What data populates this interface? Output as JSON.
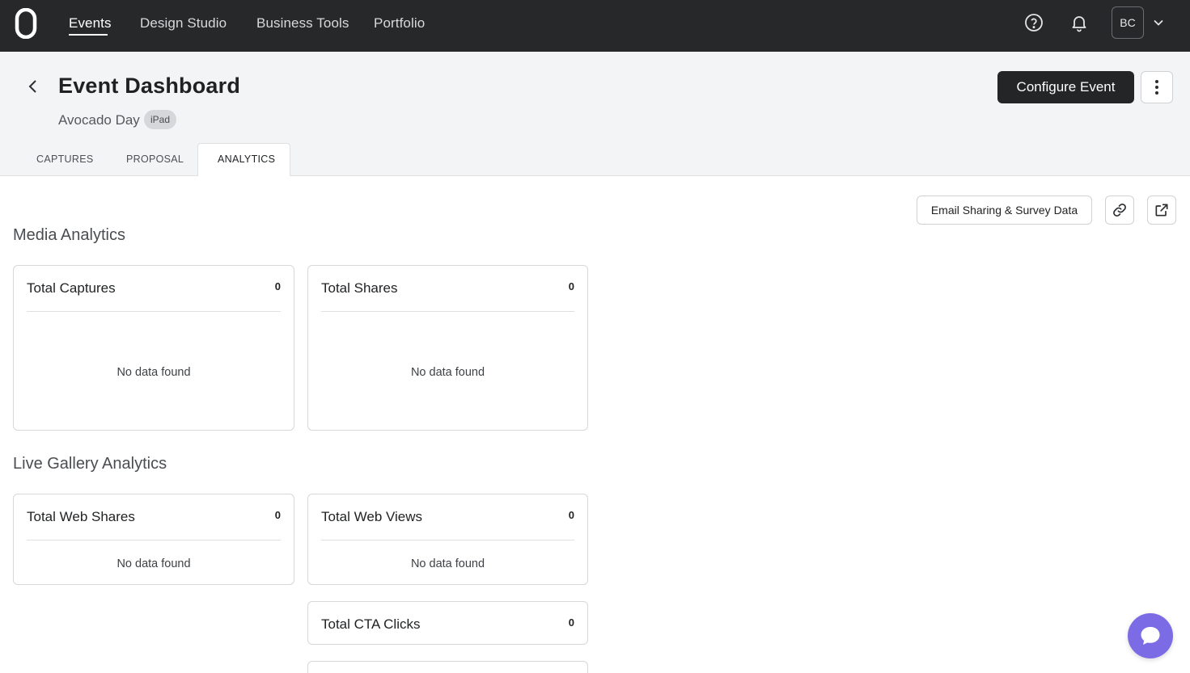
{
  "nav": {
    "items": [
      {
        "label": "Events",
        "active": true
      },
      {
        "label": "Design Studio",
        "active": false
      },
      {
        "label": "Business Tools",
        "active": false
      },
      {
        "label": "Portfolio",
        "active": false
      }
    ],
    "avatar_initials": "BC",
    "icons": [
      "help-icon",
      "bell-icon",
      "chevron-down-icon"
    ]
  },
  "header": {
    "title": "Event Dashboard",
    "event_name": "Avocado Day",
    "device_badge": "iPad",
    "configure_label": "Configure Event"
  },
  "tabs": [
    {
      "label": "CAPTURES",
      "active": false
    },
    {
      "label": "PROPOSAL",
      "active": false
    },
    {
      "label": "ANALYTICS",
      "active": true
    }
  ],
  "toolbar": {
    "email_label": "Email Sharing & Survey Data"
  },
  "media_analytics": {
    "title": "Media Analytics",
    "cards": [
      {
        "title": "Total Captures",
        "value": "0",
        "empty": "No data found"
      },
      {
        "title": "Total Shares",
        "value": "0",
        "empty": "No data found"
      }
    ]
  },
  "gallery_analytics": {
    "title": "Live Gallery Analytics",
    "cards": [
      {
        "title": "Total Web Shares",
        "value": "0",
        "empty": "No data found"
      },
      {
        "title": "Total Web Views",
        "value": "0",
        "empty": "No data found"
      },
      {
        "title": "Total CTA Clicks",
        "value": "0"
      }
    ]
  },
  "colors": {
    "nav_bg": "#26282a",
    "header_bg": "#f3f4f6",
    "primary_button": "#232527",
    "chat_accent": "#7b6ce6"
  }
}
